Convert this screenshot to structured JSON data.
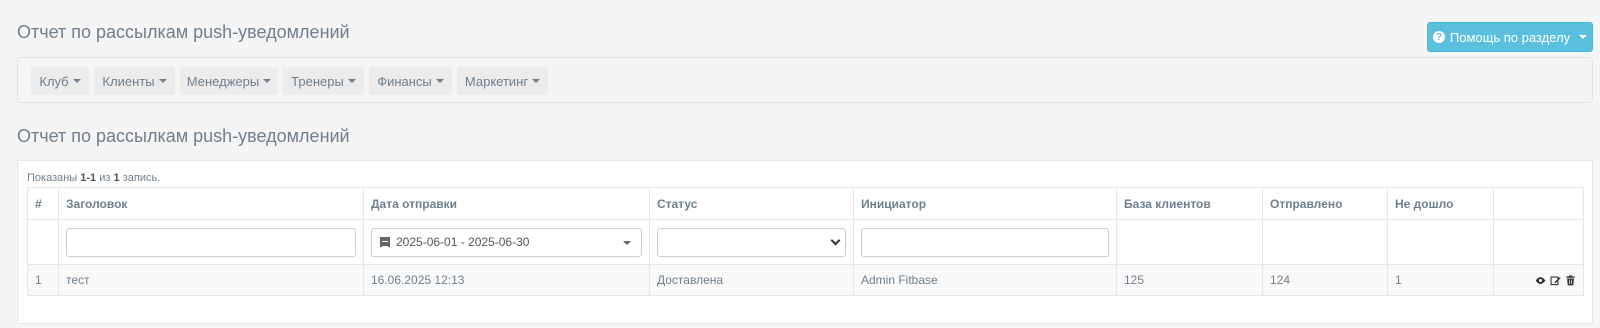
{
  "page": {
    "title": "Отчет по рассылкам push-уведомлений",
    "help_button_label": "Помощь по разделу",
    "help_icon_glyph": "?"
  },
  "nav": {
    "items": [
      {
        "label": "Клуб"
      },
      {
        "label": "Клиенты"
      },
      {
        "label": "Менеджеры"
      },
      {
        "label": "Тренеры"
      },
      {
        "label": "Финансы"
      },
      {
        "label": "Маркетинг"
      }
    ]
  },
  "section": {
    "title": "Отчет по рассылкам push-уведомлений"
  },
  "grid": {
    "summary": {
      "prefix": "Показаны",
      "range": "1-1",
      "of": "из",
      "total": "1",
      "suffix": "запись."
    },
    "columns": [
      "#",
      "Заголовок",
      "Дата отправки",
      "Статус",
      "Инициатор",
      "База клиентов",
      "Отправлено",
      "Не дошло",
      ""
    ],
    "filters": {
      "title_value": "",
      "date_range": "2025-06-01 - 2025-06-30",
      "status_value": "",
      "initiator_value": ""
    },
    "rows": [
      {
        "num": "1",
        "title": "тест",
        "date": "16.06.2025 12:13",
        "status": "Доставлена",
        "initiator": "Admin Fitbase",
        "base": "125",
        "sent": "124",
        "failed": "1"
      }
    ],
    "row_action_icons": [
      "eye-icon",
      "edit-icon",
      "trash-icon"
    ]
  },
  "colors": {
    "info_button": "#5bc0de",
    "text_muted": "#6e7f90",
    "background": "#f5f5f5"
  }
}
